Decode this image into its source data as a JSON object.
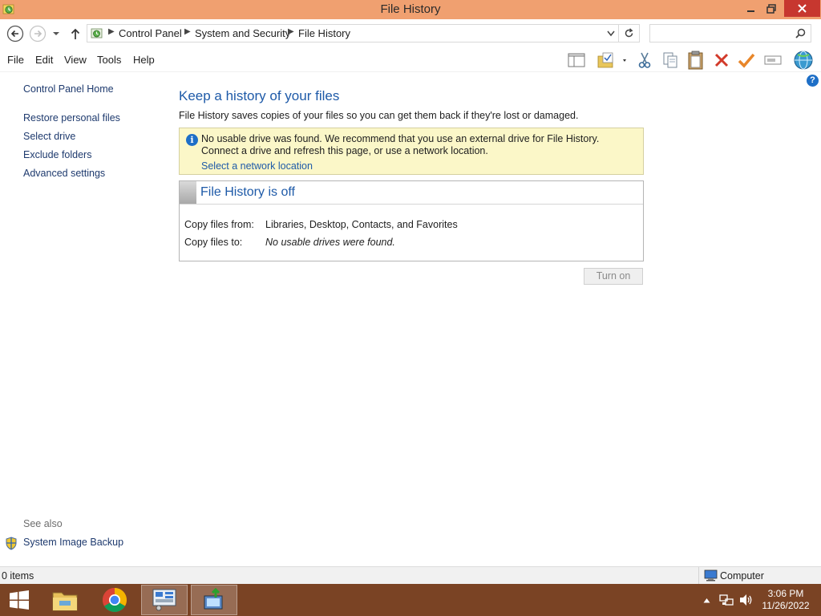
{
  "window": {
    "title": "File History"
  },
  "address": {
    "crumbs": [
      "Control Panel",
      "System and Security",
      "File History"
    ],
    "search_placeholder": ""
  },
  "menu": {
    "items": [
      "File",
      "Edit",
      "View",
      "Tools",
      "Help"
    ]
  },
  "toolbar": {
    "icons": [
      "layout-pane-icon",
      "folder-properties-icon",
      "cut-icon",
      "copy-icon",
      "paste-icon",
      "delete-icon",
      "checkmark-icon",
      "rename-icon",
      "network-icon"
    ]
  },
  "sidebar": {
    "home": "Control Panel Home",
    "items": [
      "Restore personal files",
      "Select drive",
      "Exclude folders",
      "Advanced settings"
    ],
    "see_also_title": "See also",
    "see_also_items": [
      "System Image Backup"
    ]
  },
  "main": {
    "heading": "Keep a history of your files",
    "subtitle": "File History saves copies of your files so you can get them back if they're lost or damaged.",
    "info_message": "No usable drive was found. We recommend that you use an external drive for File History. Connect a drive and refresh this page, or use a network location.",
    "info_link": "Select a network location",
    "status_title": "File History is off",
    "copy_from_label": "Copy files from:",
    "copy_from_value": "Libraries, Desktop, Contacts, and Favorites",
    "copy_to_label": "Copy files to:",
    "copy_to_value": "No usable drives were found.",
    "turn_on_label": "Turn on"
  },
  "statusbar": {
    "items_count": "0 items",
    "zone": "Computer"
  },
  "taskbar": {
    "time": "3:06 PM",
    "date": "11/26/2022"
  },
  "colors": {
    "titlebar": "#f0a070",
    "taskbar": "#7a4324",
    "link": "#1e5aa8",
    "info_bg": "#fbf7c8",
    "close_button": "#c7372f"
  }
}
